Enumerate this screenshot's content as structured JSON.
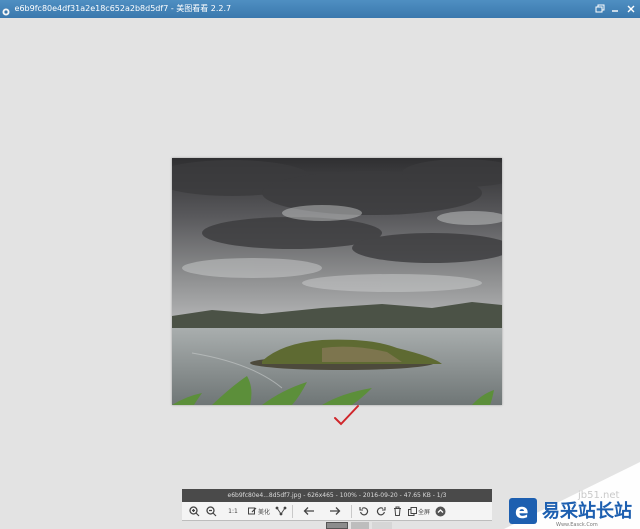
{
  "window": {
    "title": "e6b9fc80e4df31a2e18c652a2b8d5df7 - 美图看看 2.2.7",
    "titlebar_color": "#3f7fb3",
    "controls": [
      "restore-icon",
      "minimize-icon",
      "close-icon"
    ]
  },
  "viewer": {
    "background": "#e3e3e3",
    "image_subject": "landscape photo"
  },
  "annotation": {
    "checkmark_color": "#d0262b"
  },
  "infobar": {
    "text": "e6b9fc80e4...8d5df7.jpg - 626x465 - 100% - 2016-09-20 - 47.65 KB - 1/3"
  },
  "toolbar": {
    "zoom_in_icon": "zoom-in-icon",
    "zoom_out_icon": "zoom-out-icon",
    "actual_size_label": "1:1",
    "beautify_label": "美化",
    "share_icon": "share-icon",
    "prev_icon": "arrow-left-icon",
    "next_icon": "arrow-right-icon",
    "rotate_left_icon": "rotate-left-icon",
    "rotate_right_icon": "rotate-right-icon",
    "delete_icon": "trash-icon",
    "slideshow_label": "全屏",
    "more_icon": "chevron-up-icon"
  },
  "watermark": {
    "logo_letter": "e",
    "brand_text": "易采站长站",
    "url_text": "Www.Easck.Com",
    "faded_text": "jb51.net",
    "brand_color": "#1d5fb0"
  }
}
